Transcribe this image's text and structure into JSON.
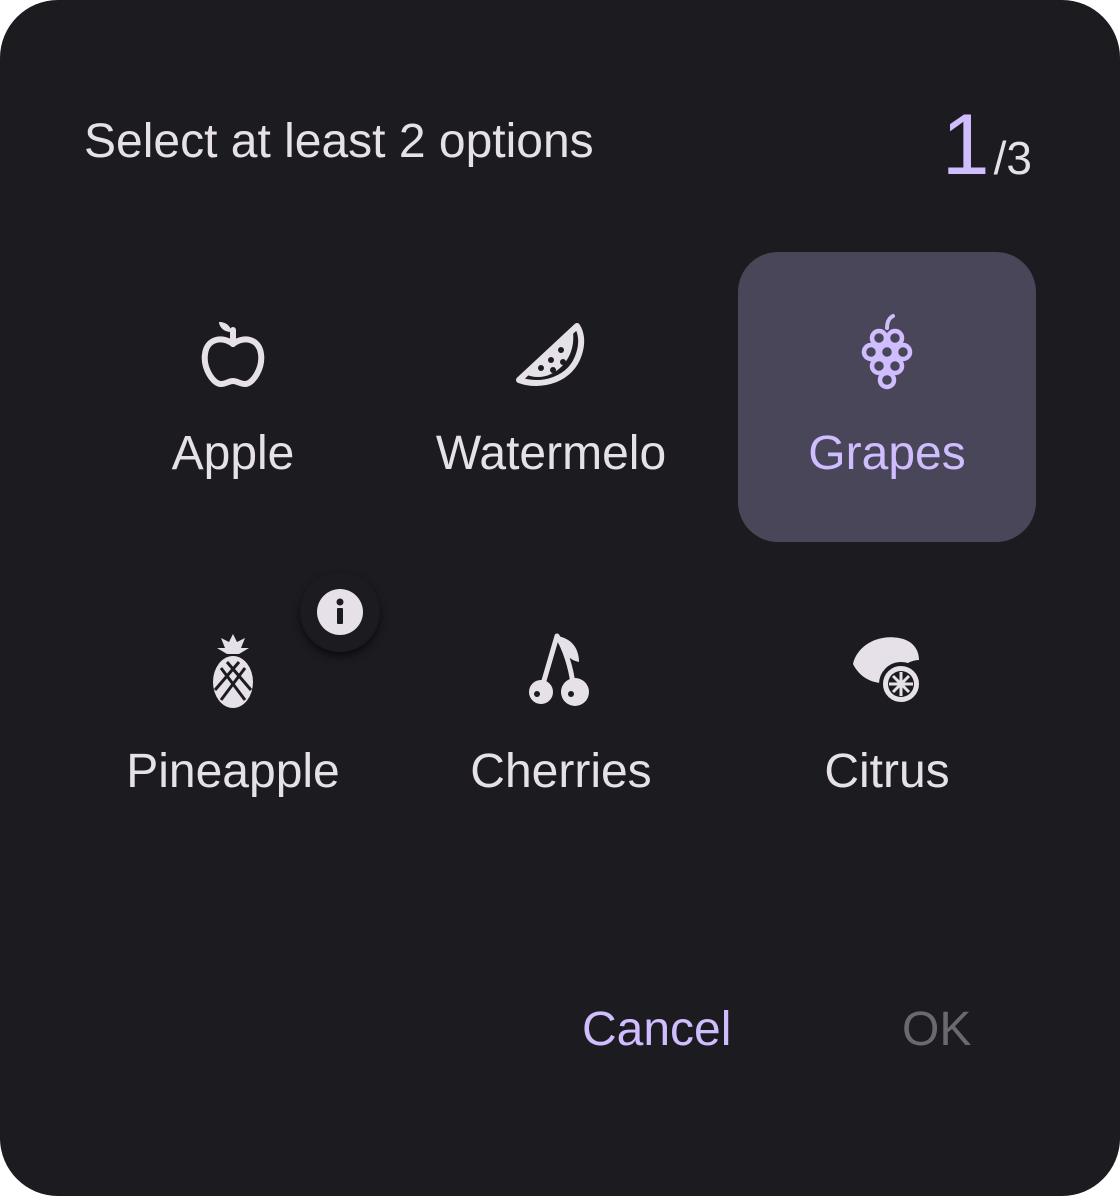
{
  "dialog": {
    "title": "Select at least 2 options",
    "counter": {
      "current": "1",
      "total": "/3"
    },
    "options": [
      {
        "label": "Apple",
        "icon": "apple-icon",
        "selected": false
      },
      {
        "label": "Watermelo",
        "icon": "watermelon-icon",
        "selected": false
      },
      {
        "label": "Grapes",
        "icon": "grapes-icon",
        "selected": true
      },
      {
        "label": "Pineapple",
        "icon": "pineapple-icon",
        "selected": false
      },
      {
        "label": "Cherries",
        "icon": "cherries-icon",
        "selected": false
      },
      {
        "label": "Citrus",
        "icon": "citrus-icon",
        "selected": false
      }
    ],
    "info_icon": "info-icon",
    "buttons": {
      "cancel": "Cancel",
      "ok": "OK",
      "ok_enabled": false
    }
  },
  "colors": {
    "surface": "#1c1b20",
    "on_surface": "#e6e1e9",
    "accent": "#cfbdfe",
    "selected_bg": "#4a4659",
    "disabled": "#6b6870"
  }
}
